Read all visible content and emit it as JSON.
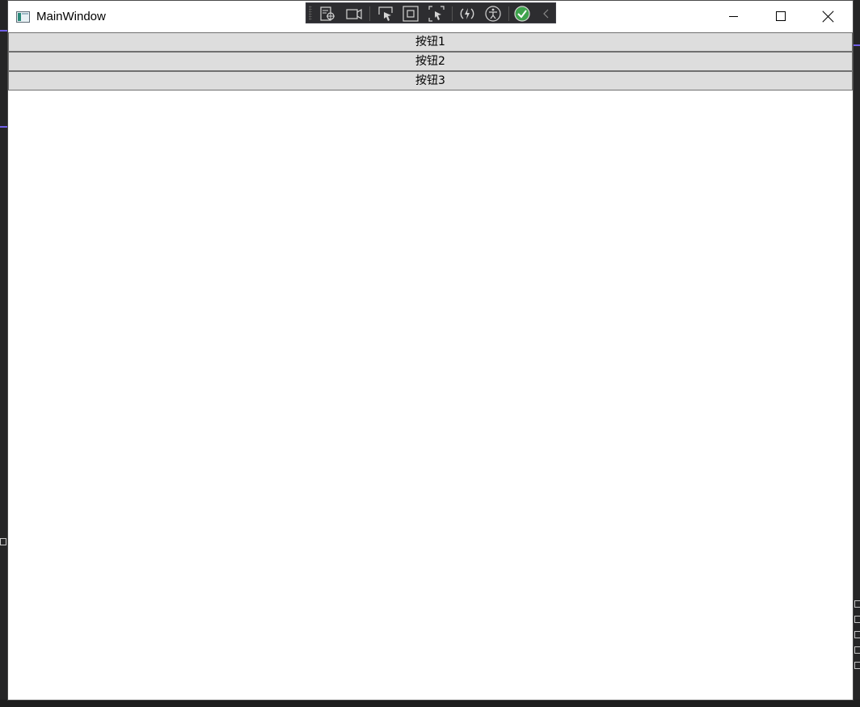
{
  "window": {
    "title": "MainWindow",
    "controls": {
      "minimize": "minimize",
      "maximize": "maximize",
      "close": "close"
    }
  },
  "debug_toolbar": {
    "icons": [
      "live-visual-tree-icon",
      "record-icon",
      "select-element-icon",
      "display-layout-adorners-icon",
      "track-focus-icon",
      "hot-reload-icon",
      "accessibility-icon",
      "binding-check-icon",
      "collapse-icon"
    ],
    "status_color": "#3fa34d"
  },
  "buttons": [
    {
      "label": "按钮1"
    },
    {
      "label": "按钮2"
    },
    {
      "label": "按钮3"
    }
  ],
  "colors": {
    "button_bg": "#dddddd",
    "button_border": "#707070",
    "accent": "#7160e8"
  }
}
